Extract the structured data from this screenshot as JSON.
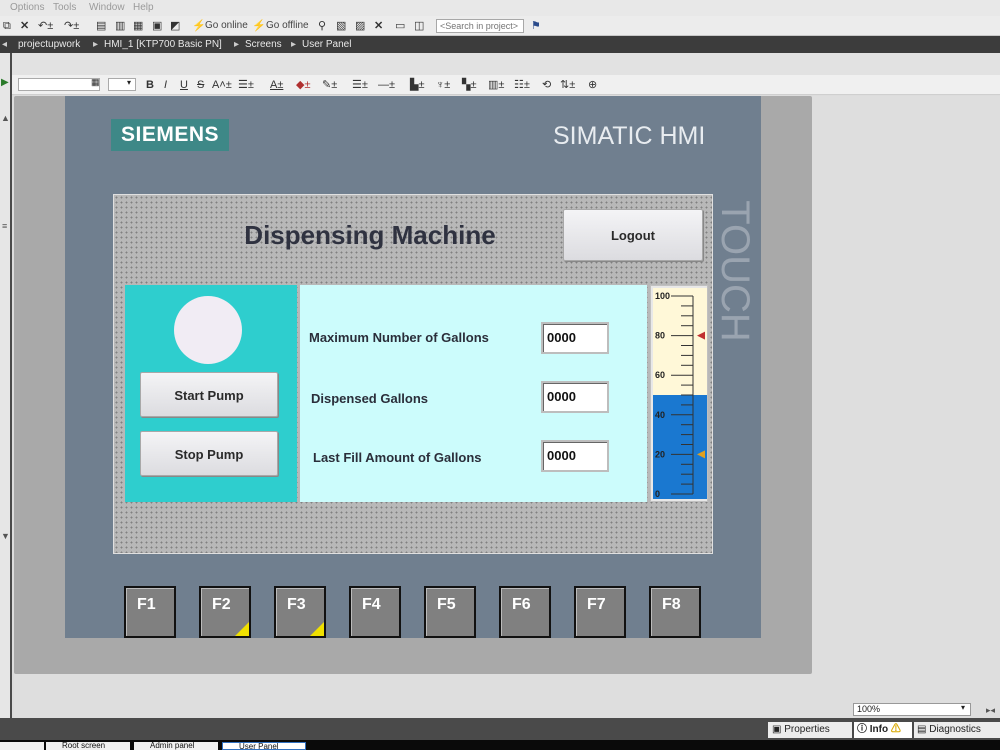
{
  "menu": {
    "items": [
      "Options",
      "Tools",
      "Window",
      "Help"
    ]
  },
  "toolbar": {
    "go_online": "Go online",
    "go_offline": "Go offline",
    "search_placeholder": "<Search in project>"
  },
  "breadcrumb": [
    "projectupwork",
    "HMI_1 [KTP700 Basic PN]",
    "Screens",
    "User Panel"
  ],
  "hmi": {
    "brand": "SIEMENS",
    "model": "SIMATIC HMI",
    "side_label": "TOUCH",
    "title": "Dispensing Machine",
    "logout_label": "Logout",
    "start_label": "Start Pump",
    "stop_label": "Stop Pump",
    "fields": [
      {
        "label": "Maximum Number of Gallons",
        "value": "0000"
      },
      {
        "label": "Dispensed Gallons",
        "value": "0000"
      },
      {
        "label": "Last Fill Amount of Gallons",
        "value": "0000"
      }
    ],
    "gauge": {
      "ticks": [
        "100",
        "80",
        "60",
        "40",
        "20",
        "0"
      ],
      "min": 0,
      "max": 100,
      "level": 50,
      "marker_high": 80,
      "marker_low": 20
    },
    "function_keys": [
      "F1",
      "F2",
      "F3",
      "F4",
      "F5",
      "F6",
      "F7",
      "F8"
    ],
    "colors": {
      "panel": "#707f8f",
      "brand": "#3e8887",
      "left_section": "#2ecece",
      "middle_section": "#ccfcfc",
      "gauge_fill": "#1a78d0"
    }
  },
  "zoom": "100%",
  "inspector": {
    "properties": "Properties",
    "info": "Info",
    "diagnostics": "Diagnostics"
  },
  "tabs": [
    "Root screen",
    "Admin panel",
    "User Panel"
  ]
}
